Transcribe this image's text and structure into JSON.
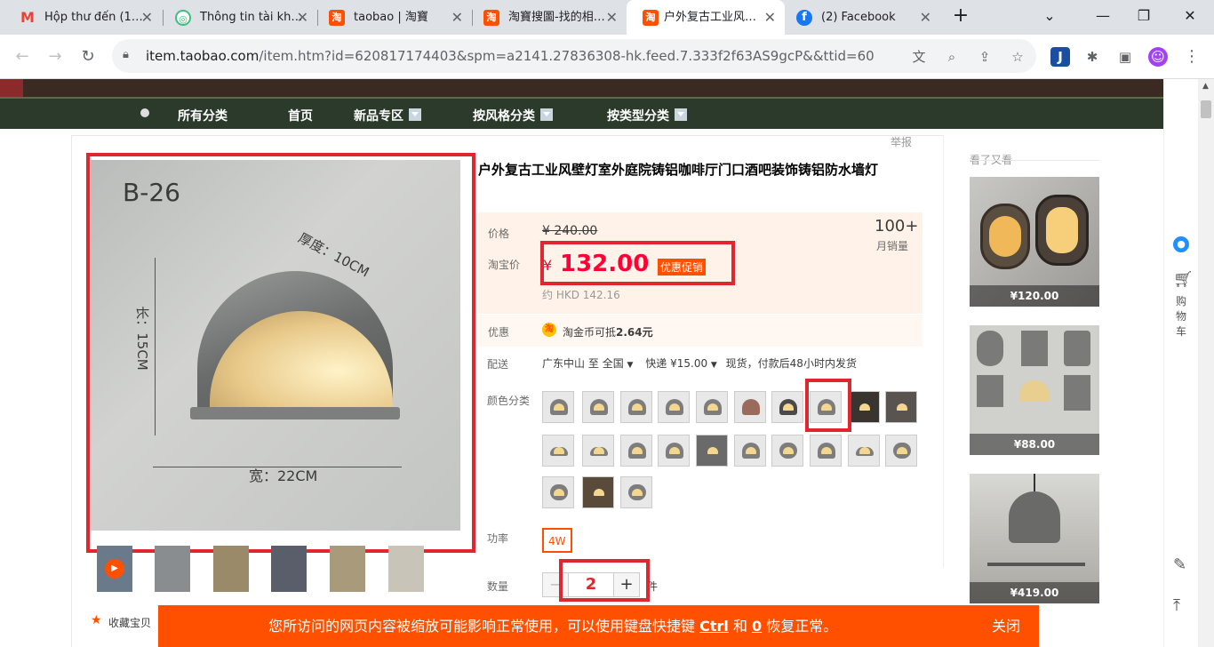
{
  "browser": {
    "tabs": [
      {
        "title": "Hộp thư đến (1…",
        "icon": "gmail-icon",
        "color": "#ea4335"
      },
      {
        "title": "Thông tin tài kh…",
        "icon": "account-icon",
        "color": "#3fbf7f"
      },
      {
        "title": "taobao | 淘寶",
        "icon": "taobao-icon",
        "color": "#ff5000"
      },
      {
        "title": "淘寶搜圖-找的相…",
        "icon": "taobao-icon",
        "color": "#ff5000"
      },
      {
        "title": "户外复古工业风…",
        "icon": "taobao-icon",
        "color": "#ff5000"
      },
      {
        "title": "(2) Facebook",
        "icon": "facebook-icon",
        "color": "#1877f2"
      }
    ],
    "url_host": "item.taobao.com",
    "url_path": "/item.htm?id=620817174403&spm=a2141.27836308-hk.feed.7.333f2f63AS9gcP&&ttid=600000%..."
  },
  "shop_nav": {
    "items": [
      "所有分类",
      "首页",
      "新品专区",
      "按风格分类",
      "按类型分类"
    ]
  },
  "report_label": "举报",
  "product": {
    "title": "户外复古工业风壁灯室外庭院铸铝咖啡厅门口酒吧装饰铸铝防水墙灯",
    "image_text": {
      "model": "B-26",
      "thickness": "厚度：10CM",
      "length": "长：15CM",
      "width": "宽：22CM"
    },
    "price_label": "价格",
    "original_price": "¥ 240.00",
    "taobao_price_label": "淘宝价",
    "currency": "¥",
    "price": "132.00",
    "promo_badge": "优惠促销",
    "hkd": "约 HKD 142.16",
    "monthly_sales": "100+",
    "monthly_sales_label": "月销量",
    "promo_label": "优惠",
    "coin_icon": "淘",
    "coin_text_prefix": "淘金币可抵",
    "coin_amount": "2.64元",
    "ship_label": "配送",
    "ship_from": "广东中山",
    "ship_to_word": "至",
    "ship_to": "全国",
    "ship_method": "快递 ¥15.00",
    "ship_note": "现货，付款后48小时内发货",
    "color_label": "颜色分类",
    "power_label": "功率",
    "power_option": "4W",
    "qty_label": "数量",
    "qty_minus": "−",
    "qty_value": "2",
    "qty_plus": "+",
    "qty_unit": "件",
    "favorite_label": "收藏宝贝"
  },
  "recommend": {
    "title": "看了又看",
    "items": [
      {
        "price": "¥120.00"
      },
      {
        "price": "¥88.00"
      },
      {
        "price": "¥419.00"
      }
    ]
  },
  "sidebar": {
    "cart_label": "购物车"
  },
  "toast": {
    "text_prefix": "您所访问的网页内容被缩放可能影响正常使用，可以使用键盘快捷键 ",
    "key1": "Ctrl",
    "and": " 和 ",
    "key2": "0",
    "text_suffix": " 恢复正常。",
    "close": "关闭"
  },
  "colors": {
    "accent": "#ff5000",
    "price_red": "#ff0036",
    "highlight": "#e0262e"
  }
}
